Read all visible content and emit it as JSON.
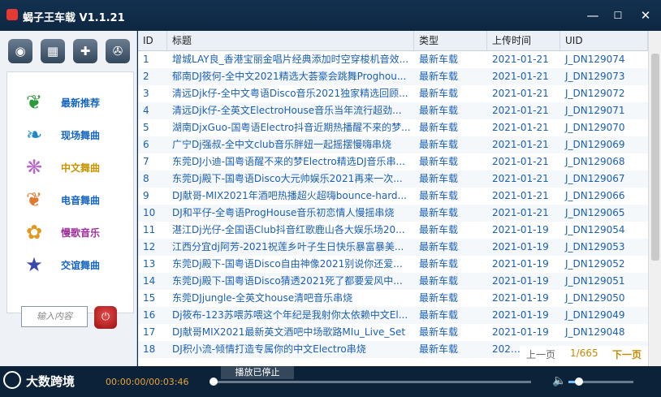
{
  "window": {
    "title": "蝎子王车载 V1.1.21",
    "min": "—",
    "max": "☐",
    "close": "✕"
  },
  "left_panel": {
    "top_icons": [
      {
        "name": "vortex-icon",
        "glyph": "◉"
      },
      {
        "name": "puzzle-icon",
        "glyph": "▦"
      },
      {
        "name": "apps-icon",
        "glyph": "✚"
      },
      {
        "name": "film-reel-icon",
        "glyph": "✇"
      }
    ],
    "menu": [
      {
        "label": "最新推荐",
        "color": "#1565c0",
        "glyph": "❦",
        "glyph_color": "#2e9b3a"
      },
      {
        "label": "现场舞曲",
        "color": "#1565c0",
        "glyph": "❧",
        "glyph_color": "#1e88c8"
      },
      {
        "label": "中文舞曲",
        "color": "#c69400",
        "glyph": "❋",
        "glyph_color": "#b868c8"
      },
      {
        "label": "电音舞曲",
        "color": "#1565c0",
        "glyph": "❦",
        "glyph_color": "#e07a30"
      },
      {
        "label": "慢歌音乐",
        "color": "#a0309c",
        "glyph": "✿",
        "glyph_color": "#e09a20"
      },
      {
        "label": "交谊舞曲",
        "color": "#1565c0",
        "glyph": "★",
        "glyph_color": "#3a4aa8"
      }
    ],
    "search_placeholder": "输入内容",
    "search_button": "⏻"
  },
  "table": {
    "columns": [
      "ID",
      "标题",
      "类型",
      "上传时间",
      "UID"
    ],
    "rows": [
      [
        "1",
        "增城LAY良_香港宝丽金唱片经典添加时空穿梭机音效...",
        "最新车载",
        "2021-01-21",
        "J_DN129074"
      ],
      [
        "2",
        "郁南DJ筱何-全中文2021精选大荟豪会跳舞Proghou...",
        "最新车载",
        "2021-01-21",
        "J_DN129073"
      ],
      [
        "3",
        "清远Djk仔-全中文粤语Disco音乐2021独家精选回顾...",
        "最新车载",
        "2021-01-21",
        "J_DN129072"
      ],
      [
        "4",
        "清远Djk仔-全英文ElectroHouse音乐当年流行超劲...",
        "最新车载",
        "2021-01-21",
        "J_DN129071"
      ],
      [
        "5",
        "湖南DjxGuo-国粤语Electro抖音近期热播醒不来的梦...",
        "最新车载",
        "2021-01-21",
        "J_DN129070"
      ],
      [
        "6",
        "广宁Dj强叔-全中文club音乐胖妞一起摇摆慢嗨串烧",
        "最新车载",
        "2021-01-21",
        "J_DN129069"
      ],
      [
        "7",
        "东莞DJ小迪-国粤语醒不来的梦Electro精选DJ音乐串...",
        "最新车载",
        "2021-01-21",
        "J_DN129068"
      ],
      [
        "8",
        "东莞Dj殿下-国粤语Disco大元帅娱乐2021再来一次...",
        "最新车载",
        "2021-01-21",
        "J_DN129067"
      ],
      [
        "9",
        "DJ献哥-MIX2021年酒吧热播超火超嗨bounce-hard...",
        "最新车载",
        "2021-01-21",
        "J_DN129066"
      ],
      [
        "10",
        "DJ和平仔-全粤语ProgHouse音乐初恋情人慢摇串烧",
        "最新车载",
        "2021-01-21",
        "J_DN129065"
      ],
      [
        "11",
        "湛江Dj光仔-全国语Club抖音红歌鹿山各大娱乐场20...",
        "最新车载",
        "2021-01-19",
        "J_DN129054"
      ],
      [
        "12",
        "江西分宜dj阿芳-2021祝莲乡叶子生日快乐暴富暴美...",
        "最新车载",
        "2021-01-19",
        "J_DN129053"
      ],
      [
        "13",
        "东莞Dj殿下-国粤语Disco自由神像2021别说你还爱...",
        "最新车载",
        "2021-01-19",
        "J_DN129052"
      ],
      [
        "14",
        "东莞Dj殿下-国粤语Disco猜透2021死了都要爱风中...",
        "最新车载",
        "2021-01-19",
        "J_DN129051"
      ],
      [
        "15",
        "东莞DJjungle-全英文house清吧音乐串烧",
        "最新车载",
        "2021-01-19",
        "J_DN129050"
      ],
      [
        "16",
        "Dj筱布-123苏喂苏喂这个年纪是我射你太依赖中文El...",
        "最新车载",
        "2021-01-19",
        "J_DN129049"
      ],
      [
        "17",
        "DJ献哥MIX2021最新英文酒吧中场歌路MIu_Live_Set",
        "最新车载",
        "2021-01-19",
        "J_DN129048"
      ],
      [
        "18",
        "DJ积小流-倾情打造专属你的中文Electro串烧",
        "最新车载",
        "2021-0",
        ""
      ]
    ],
    "pager": {
      "prev": "上一页",
      "page": "1/665",
      "next": "下一页"
    }
  },
  "player": {
    "brand": "大数跨境",
    "time": "00:00:00/00:03:46",
    "status": "播放已停止",
    "progress": 0.0,
    "volume": 0.16
  }
}
